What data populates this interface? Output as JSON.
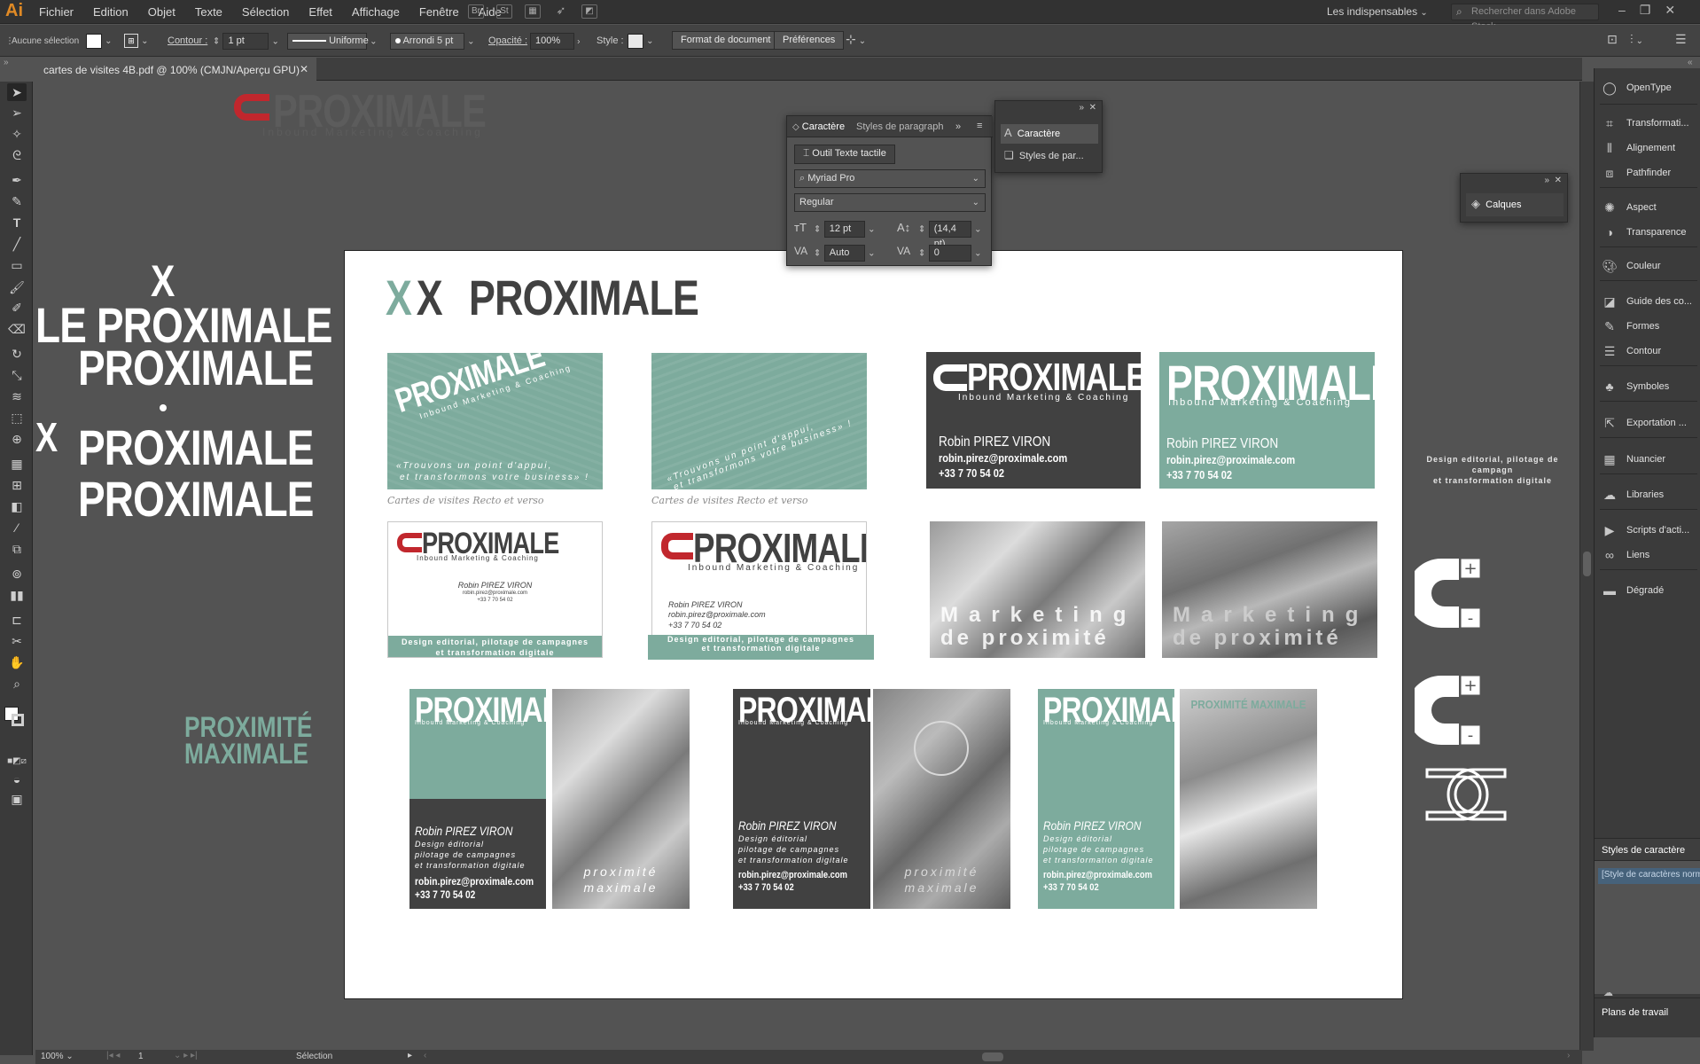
{
  "app": {
    "logo": "Ai"
  },
  "menu": [
    "Fichier",
    "Edition",
    "Objet",
    "Texte",
    "Sélection",
    "Effet",
    "Affichage",
    "Fenêtre",
    "Aide"
  ],
  "menubar_icons": [
    "Br",
    "St"
  ],
  "workspace": "Les indispensables",
  "search_placeholder": "Rechercher dans Adobe Stock",
  "control": {
    "selection": "Aucune sélection",
    "contour_label": "Contour :",
    "contour_value": "1 pt",
    "stroke_style": "Uniforme",
    "brush": "Arrondi 5 pt",
    "opacity_label": "Opacité :",
    "opacity_value": "100%",
    "style_label": "Style :",
    "doc_button": "Format de document",
    "prefs_button": "Préférences"
  },
  "tab": {
    "title": "cartes de visites 4B.pdf @ 100% (CMJN/Aperçu GPU)"
  },
  "char_panel": {
    "tab_active": "Caractère",
    "tab_inactive": "Styles de paragraph",
    "touch_tool": "Outil Texte tactile",
    "font": "Myriad Pro",
    "style": "Regular",
    "size": "12 pt",
    "leading": "(14,4 pt)",
    "kerning": "Auto",
    "tracking": "0"
  },
  "mini_panel": {
    "item1": "Caractère",
    "item2": "Styles de par..."
  },
  "layers_panel": {
    "label": "Calques"
  },
  "right_panel": [
    "OpenType",
    "Transformati...",
    "Alignement",
    "Pathfinder",
    "Aspect",
    "Transparence",
    "Couleur",
    "Guide des co...",
    "Formes",
    "Contour",
    "Symboles",
    "Exportation ...",
    "Nuancier",
    "Libraries",
    "Scripts d'acti...",
    "Liens",
    "Dégradé"
  ],
  "styles_panel": {
    "title": "Styles de caractère",
    "item": "[Style de caractères norm"
  },
  "plans_panel": {
    "title": "Plans de travail"
  },
  "status": {
    "zoom": "100%",
    "page": "1",
    "tool": "Sélection"
  },
  "pasteboard": {
    "top_logo": "PROXIMALE",
    "top_logo_sub": "Inbound Marketing & Coaching",
    "le_proximale": "LE PROXIMALE",
    "proximale_1": "PROXIMALE",
    "proximale_2": "PROXIMALE",
    "proximale_3": "PROXIMALE",
    "proximite": "PROXIMITÉ",
    "maximale": "MAXIMALE",
    "design_line1": "Design editorial, pilotage de campagn",
    "design_line2": "et transformation digitale"
  },
  "artboard": {
    "logo_xx": "XX",
    "logo": "PROXIMALE",
    "brand": "PROXIMALE",
    "tagline": "Inbound Marketing & Coaching",
    "name": "Robin PIREZ VIRON",
    "email": "robin.pirez@proximale.com",
    "phone": "+33 7 70 54 02",
    "slogan1": "«Trouvons un point d'appui,",
    "slogan2": "et transformons votre business» !",
    "caption": "Cartes de visites Recto et verso",
    "design1": "Design editorial, pilotage de campagnes",
    "design2": "et transformation digitale",
    "mk1": "Marketing",
    "mk2": "de proximité",
    "job1": "Design éditorial",
    "job2": "pilotage de campagnes",
    "job3": "et transformation digitale",
    "prox1": "proximité",
    "prox2": "maximale",
    "prox_max": "PROXIMITÉ MAXIMALE"
  }
}
